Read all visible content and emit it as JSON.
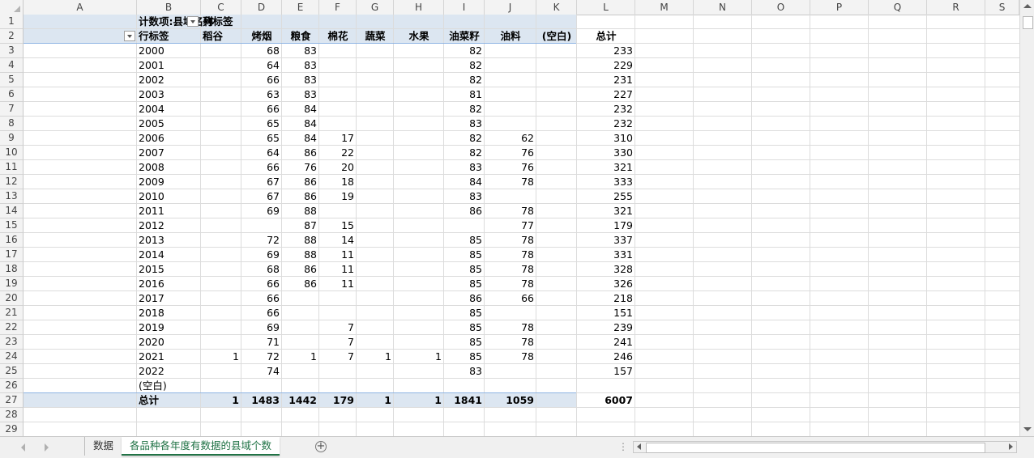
{
  "columns": [
    "A",
    "B",
    "C",
    "D",
    "E",
    "F",
    "G",
    "H",
    "I",
    "J",
    "K",
    "L",
    "M",
    "N",
    "O",
    "P",
    "Q",
    "R",
    "S"
  ],
  "row_numbers": [
    "1",
    "2",
    "3",
    "4",
    "5",
    "6",
    "7",
    "8",
    "9",
    "10",
    "11",
    "12",
    "13",
    "14",
    "15",
    "16",
    "17",
    "18",
    "19",
    "20",
    "21",
    "22",
    "23",
    "24",
    "25",
    "26",
    "27",
    "28",
    "29"
  ],
  "pivot": {
    "value_field_label": "计数项:县域名称",
    "column_labels_caption": "列标签",
    "row_labels_caption": "行标签",
    "headers": [
      "稻谷",
      "烤烟",
      "粮食",
      "棉花",
      "蔬菜",
      "水果",
      "油菜籽",
      "油料",
      "(空白)",
      "总计"
    ],
    "rows": [
      {
        "label": "2000",
        "vals": [
          "",
          "68",
          "83",
          "",
          "",
          "",
          "82",
          "",
          "",
          "233"
        ]
      },
      {
        "label": "2001",
        "vals": [
          "",
          "64",
          "83",
          "",
          "",
          "",
          "82",
          "",
          "",
          "229"
        ]
      },
      {
        "label": "2002",
        "vals": [
          "",
          "66",
          "83",
          "",
          "",
          "",
          "82",
          "",
          "",
          "231"
        ]
      },
      {
        "label": "2003",
        "vals": [
          "",
          "63",
          "83",
          "",
          "",
          "",
          "81",
          "",
          "",
          "227"
        ]
      },
      {
        "label": "2004",
        "vals": [
          "",
          "66",
          "84",
          "",
          "",
          "",
          "82",
          "",
          "",
          "232"
        ]
      },
      {
        "label": "2005",
        "vals": [
          "",
          "65",
          "84",
          "",
          "",
          "",
          "83",
          "",
          "",
          "232"
        ]
      },
      {
        "label": "2006",
        "vals": [
          "",
          "65",
          "84",
          "17",
          "",
          "",
          "82",
          "62",
          "",
          "310"
        ]
      },
      {
        "label": "2007",
        "vals": [
          "",
          "64",
          "86",
          "22",
          "",
          "",
          "82",
          "76",
          "",
          "330"
        ]
      },
      {
        "label": "2008",
        "vals": [
          "",
          "66",
          "76",
          "20",
          "",
          "",
          "83",
          "76",
          "",
          "321"
        ]
      },
      {
        "label": "2009",
        "vals": [
          "",
          "67",
          "86",
          "18",
          "",
          "",
          "84",
          "78",
          "",
          "333"
        ]
      },
      {
        "label": "2010",
        "vals": [
          "",
          "67",
          "86",
          "19",
          "",
          "",
          "83",
          "",
          "",
          "255"
        ]
      },
      {
        "label": "2011",
        "vals": [
          "",
          "69",
          "88",
          "",
          "",
          "",
          "86",
          "78",
          "",
          "321"
        ]
      },
      {
        "label": "2012",
        "vals": [
          "",
          "",
          "87",
          "15",
          "",
          "",
          "",
          "77",
          "",
          "179"
        ]
      },
      {
        "label": "2013",
        "vals": [
          "",
          "72",
          "88",
          "14",
          "",
          "",
          "85",
          "78",
          "",
          "337"
        ]
      },
      {
        "label": "2014",
        "vals": [
          "",
          "69",
          "88",
          "11",
          "",
          "",
          "85",
          "78",
          "",
          "331"
        ]
      },
      {
        "label": "2015",
        "vals": [
          "",
          "68",
          "86",
          "11",
          "",
          "",
          "85",
          "78",
          "",
          "328"
        ]
      },
      {
        "label": "2016",
        "vals": [
          "",
          "66",
          "86",
          "11",
          "",
          "",
          "85",
          "78",
          "",
          "326"
        ]
      },
      {
        "label": "2017",
        "vals": [
          "",
          "66",
          "",
          "",
          "",
          "",
          "86",
          "66",
          "",
          "218"
        ]
      },
      {
        "label": "2018",
        "vals": [
          "",
          "66",
          "",
          "",
          "",
          "",
          "85",
          "",
          "",
          "151"
        ]
      },
      {
        "label": "2019",
        "vals": [
          "",
          "69",
          "",
          "7",
          "",
          "",
          "85",
          "78",
          "",
          "239"
        ]
      },
      {
        "label": "2020",
        "vals": [
          "",
          "71",
          "",
          "7",
          "",
          "",
          "85",
          "78",
          "",
          "241"
        ]
      },
      {
        "label": "2021",
        "vals": [
          "1",
          "72",
          "1",
          "7",
          "1",
          "1",
          "85",
          "78",
          "",
          "246"
        ]
      },
      {
        "label": "2022",
        "vals": [
          "",
          "74",
          "",
          "",
          "",
          "",
          "83",
          "",
          "",
          "157"
        ]
      },
      {
        "label": "(空白)",
        "vals": [
          "",
          "",
          "",
          "",
          "",
          "",
          "",
          "",
          "",
          ""
        ]
      }
    ],
    "total": {
      "label": "总计",
      "vals": [
        "1",
        "1483",
        "1442",
        "179",
        "1",
        "1",
        "1841",
        "1059",
        "",
        "6007"
      ]
    }
  },
  "sheet_tabs": {
    "inactive": "数据",
    "active": "各品种各年度有数据的县域个数"
  },
  "add_sheet_symbol": "+",
  "scroll_dots": "⋮"
}
